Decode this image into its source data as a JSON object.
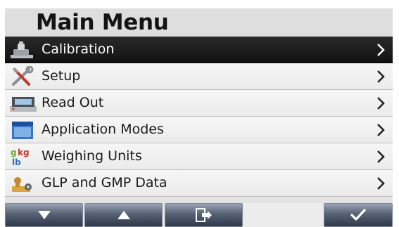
{
  "header": {
    "title": "Main Menu"
  },
  "menu": {
    "items": [
      {
        "label": "Calibration",
        "icon": "calibration-weight-icon",
        "selected": true
      },
      {
        "label": "Setup",
        "icon": "setup-tools-icon",
        "selected": false
      },
      {
        "label": "Read Out",
        "icon": "read-out-display-icon",
        "selected": false
      },
      {
        "label": "Application Modes",
        "icon": "application-modes-icon",
        "selected": false
      },
      {
        "label": "Weighing Units",
        "icon": "weighing-units-icon",
        "selected": false
      },
      {
        "label": "GLP and GMP Data",
        "icon": "glp-gmp-data-icon",
        "selected": false
      }
    ]
  },
  "softkeys": [
    {
      "name": "down-arrow",
      "icon": "arrow-down-icon"
    },
    {
      "name": "up-arrow",
      "icon": "arrow-up-icon"
    },
    {
      "name": "exit",
      "icon": "exit-icon"
    },
    {
      "name": "confirm",
      "icon": "checkmark-icon"
    }
  ],
  "colors": {
    "selected_row": "#1a1a1a",
    "row_background": "#f2f2f2",
    "softkey_top": "#9aa5b5",
    "softkey_bottom": "#2f3a4b"
  }
}
